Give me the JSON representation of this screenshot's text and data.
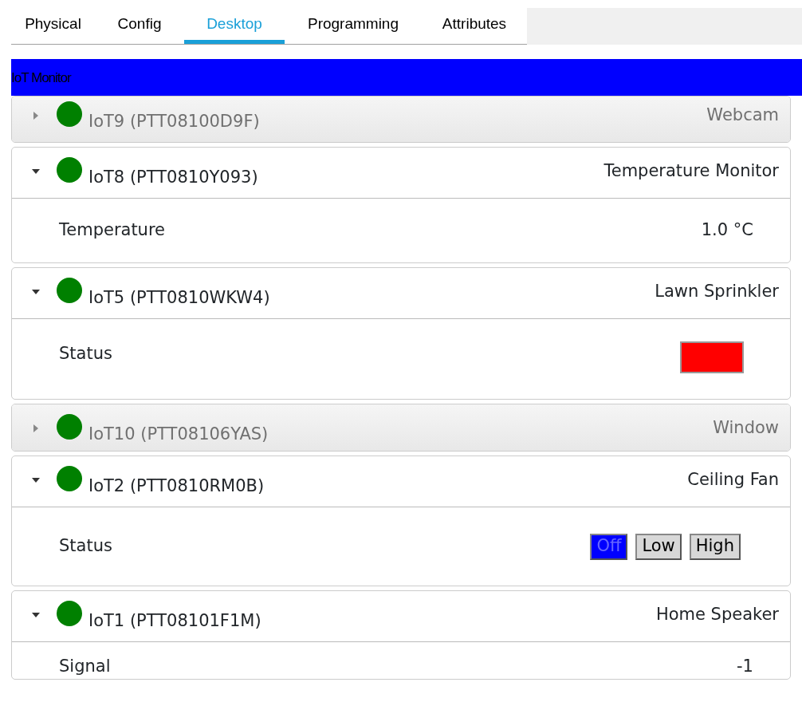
{
  "tabs": [
    {
      "label": "Physical",
      "selected": false
    },
    {
      "label": "Config",
      "selected": false
    },
    {
      "label": "Desktop",
      "selected": true
    },
    {
      "label": "Programming",
      "selected": false
    },
    {
      "label": "Attributes",
      "selected": false
    }
  ],
  "app_title": "IoT Monitor",
  "devices": [
    {
      "name": "IoT9 (PTT08100D9F)",
      "type": "Webcam",
      "expanded": false,
      "online": true
    },
    {
      "name": "IoT8 (PTT0810Y093)",
      "type": "Temperature Monitor",
      "expanded": true,
      "online": true,
      "rows": [
        {
          "kind": "value",
          "label": "Temperature",
          "value": "1.0 °C"
        }
      ]
    },
    {
      "name": "IoT5 (PTT0810WKW4)",
      "type": "Lawn Sprinkler",
      "expanded": true,
      "online": true,
      "rows": [
        {
          "kind": "indicator",
          "label": "Status",
          "color": "#ff0000"
        }
      ]
    },
    {
      "name": "IoT10 (PTT08106YAS)",
      "type": "Window",
      "expanded": false,
      "online": true
    },
    {
      "name": "IoT2 (PTT0810RM0B)",
      "type": "Ceiling Fan",
      "expanded": true,
      "online": true,
      "rows": [
        {
          "kind": "buttons",
          "label": "Status",
          "options": [
            {
              "label": "Off",
              "selected": true
            },
            {
              "label": "Low",
              "selected": false
            },
            {
              "label": "High",
              "selected": false
            }
          ]
        }
      ]
    },
    {
      "name": "IoT1 (PTT08101F1M)",
      "type": "Home Speaker",
      "expanded": true,
      "online": true,
      "rows": [
        {
          "kind": "value",
          "label": "Signal",
          "value": "-1"
        }
      ]
    }
  ]
}
